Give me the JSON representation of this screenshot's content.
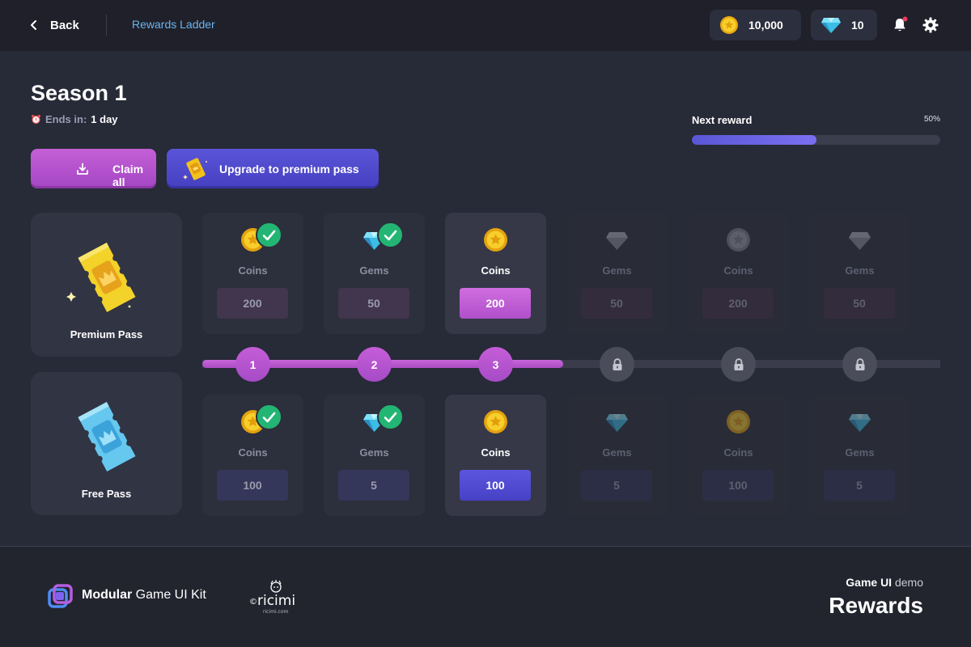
{
  "header": {
    "back_label": "Back",
    "breadcrumb": "Rewards Ladder",
    "coins": "10,000",
    "gems": "10"
  },
  "season": {
    "title": "Season 1",
    "ends_label": "Ends in:",
    "ends_value": "1 day",
    "next_reward_label": "Next reward",
    "next_reward_pct_text": "50%",
    "next_reward_progress": 0.5
  },
  "actions": {
    "claim_all": "Claim all",
    "upgrade": "Upgrade to premium pass"
  },
  "passes": {
    "premium": "Premium Pass",
    "free": "Free Pass"
  },
  "premium_rewards": [
    {
      "label": "Coins",
      "value": "200",
      "icon": "coin-icon",
      "state": "claimed"
    },
    {
      "label": "Gems",
      "value": "50",
      "icon": "gem-icon",
      "state": "claimed"
    },
    {
      "label": "Coins",
      "value": "200",
      "icon": "coin-icon",
      "state": "active"
    },
    {
      "label": "Gems",
      "value": "50",
      "icon": "gem-icon",
      "state": "locked"
    },
    {
      "label": "Coins",
      "value": "200",
      "icon": "coin-icon",
      "state": "locked"
    },
    {
      "label": "Gems",
      "value": "50",
      "icon": "gem-icon",
      "state": "locked"
    }
  ],
  "free_rewards": [
    {
      "label": "Coins",
      "value": "100",
      "icon": "coin-icon",
      "state": "claimed"
    },
    {
      "label": "Gems",
      "value": "5",
      "icon": "gem-icon",
      "state": "claimed"
    },
    {
      "label": "Coins",
      "value": "100",
      "icon": "coin-icon",
      "state": "active"
    },
    {
      "label": "Gems",
      "value": "5",
      "icon": "gem-icon",
      "state": "locked"
    },
    {
      "label": "Coins",
      "value": "100",
      "icon": "coin-icon",
      "state": "locked"
    },
    {
      "label": "Gems",
      "value": "5",
      "icon": "gem-icon",
      "state": "locked"
    }
  ],
  "levels": [
    {
      "label": "1",
      "state": "done"
    },
    {
      "label": "2",
      "state": "done"
    },
    {
      "label": "3",
      "state": "done"
    },
    {
      "label": "",
      "state": "locked"
    },
    {
      "label": "",
      "state": "locked"
    },
    {
      "label": "",
      "state": "locked"
    }
  ],
  "footer": {
    "kit_bold": "Modular",
    "kit_rest": " Game UI Kit",
    "brand": "ricimi",
    "brand_url": "ricimi.com",
    "demo_bold": "Game UI",
    "demo_rest": " demo",
    "demo_title": "Rewards"
  },
  "colors": {
    "accent_purple": "#b04fcb",
    "accent_indigo": "#4741c6",
    "claimed_green": "#23b573",
    "coin_gold": "#f3c21c",
    "gem_cyan": "#46c7e8"
  }
}
